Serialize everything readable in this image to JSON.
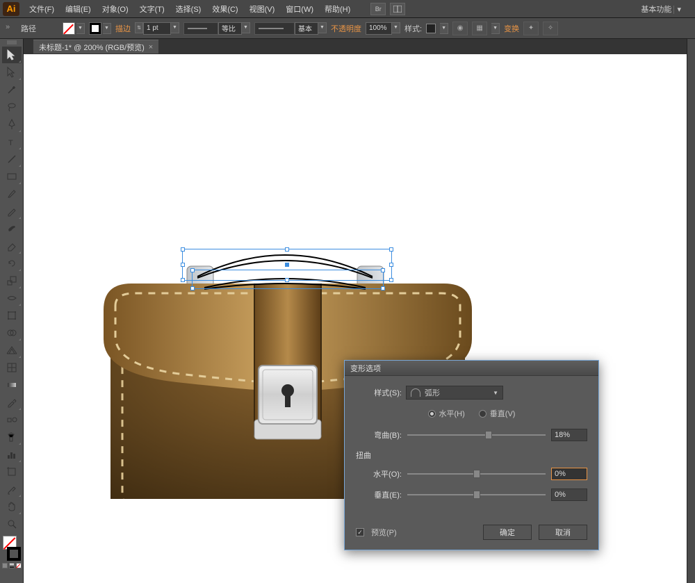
{
  "app": {
    "logo": "Ai"
  },
  "menu": [
    "文件(F)",
    "编辑(E)",
    "对象(O)",
    "文字(T)",
    "选择(S)",
    "效果(C)",
    "视图(V)",
    "窗口(W)",
    "帮助(H)"
  ],
  "bridge": "Br",
  "workspace": "基本功能",
  "control": {
    "object": "路径",
    "stroke_label": "描边",
    "stroke_weight": "1 pt",
    "profile_label1": "等比",
    "profile_label2": "基本",
    "opacity_label": "不透明度",
    "opacity_value": "100%",
    "style_label": "样式:",
    "transform_label": "变换"
  },
  "document": {
    "tab": "未标题-1* @ 200% (RGB/预览)"
  },
  "dialog": {
    "title": "变形选项",
    "style_label": "样式(S):",
    "style_value": "弧形",
    "horizontal": "水平(H)",
    "vertical": "垂直(V)",
    "bend_label": "弯曲(B):",
    "bend_value": "18%",
    "distort_label": "扭曲",
    "h_label": "水平(O):",
    "h_value": "0%",
    "v_label": "垂直(E):",
    "v_value": "0%",
    "preview": "预览(P)",
    "ok": "确定",
    "cancel": "取消"
  }
}
